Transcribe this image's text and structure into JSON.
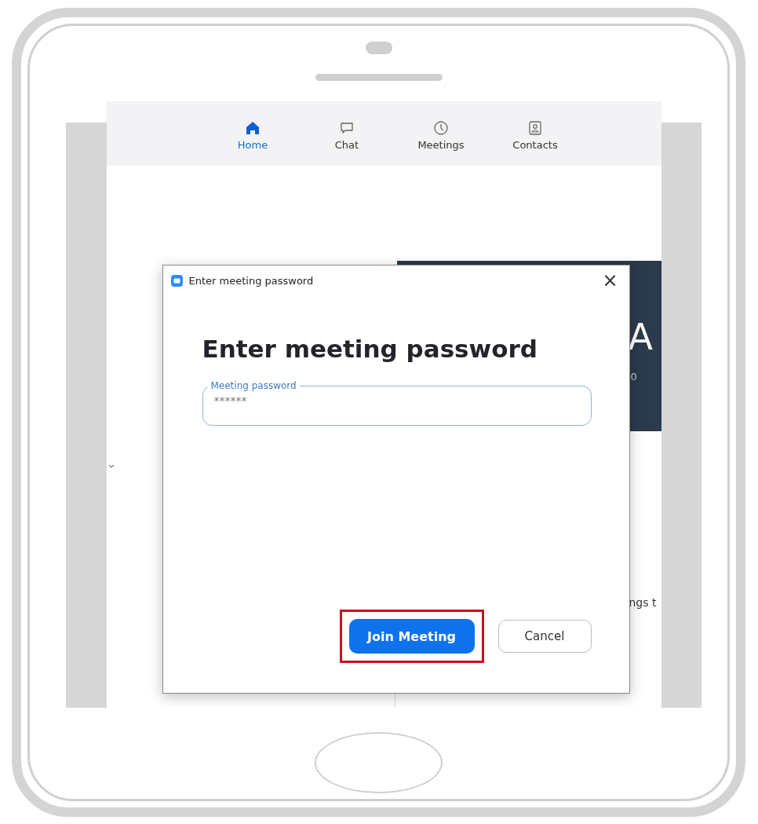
{
  "nav_tabs": [
    {
      "label": "Home",
      "selected": true
    },
    {
      "label": "Chat",
      "selected": false
    },
    {
      "label": "Meetings",
      "selected": false
    },
    {
      "label": "Contacts",
      "selected": false
    }
  ],
  "background": {
    "banner_title": "A",
    "banner_subtitle": "0",
    "side_text": "ngs t"
  },
  "dialog": {
    "title": "Enter meeting password",
    "close": "×",
    "heading": "Enter meeting password",
    "field": {
      "label": "Meeting password",
      "value": "******"
    },
    "buttons": [
      {
        "label": "Join Meeting",
        "kind": "primary",
        "highlighted": true
      },
      {
        "label": "Cancel",
        "kind": "secondary",
        "highlighted": false
      }
    ]
  }
}
